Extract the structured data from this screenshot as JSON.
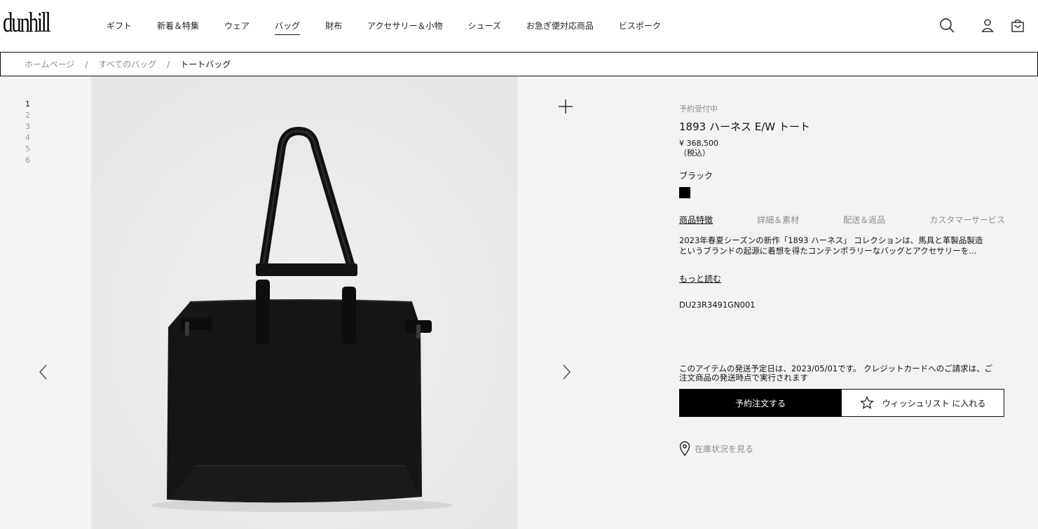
{
  "brand": {
    "logo_text": "dunhill"
  },
  "nav": {
    "items": [
      {
        "label": "ギフト"
      },
      {
        "label": "新着＆特集"
      },
      {
        "label": "ウェア"
      },
      {
        "label": "バッグ"
      },
      {
        "label": "財布"
      },
      {
        "label": "アクセサリー＆小物"
      },
      {
        "label": "シューズ"
      },
      {
        "label": "お急ぎ便対応商品"
      },
      {
        "label": "ビスポーク"
      }
    ],
    "active_index": 3
  },
  "header_icons": [
    "search-icon",
    "account-icon",
    "bag-icon"
  ],
  "breadcrumb": {
    "items": [
      "ホームページ",
      "すべてのバッグ",
      "トートバッグ"
    ],
    "separator": "/"
  },
  "gallery": {
    "thumbnails": [
      "1",
      "2",
      "3",
      "4",
      "5",
      "6"
    ],
    "active_index": 0
  },
  "product": {
    "status": "予約受付中",
    "title": "1893 ハーネス E/W トート",
    "price": "¥ 368,500",
    "tax_note": "（税込）",
    "color_name": "ブラック",
    "swatch_color": "#000000",
    "tabs": [
      "商品特徴",
      "詳細＆素材",
      "配送＆返品",
      "カスタマーサービス"
    ],
    "description_line1": "2023年春夏シーズンの新作「1893 ハーネス」 コレクションは、馬具と革製品製造",
    "description_line2": "というブランドの起源に着想を得たコンテンポラリーなバッグとアクセサリーを...",
    "read_more": "もっと読む",
    "sku": "DU23R3491GN001",
    "shipping_line1": "このアイテムの発送予定日は、2023/05/01です。 クレジットカードへのご請求は、ご",
    "shipping_line2": "注文商品の発送時点で実行されます",
    "order_button": "予約注文する",
    "wishlist_button": "ウィッシュリスト に入れる",
    "stock_link": "在庫状況を見る"
  },
  "colors": {
    "accent": "#000000",
    "muted_text": "#8a8a8a",
    "page_bg": "#f3f3f3"
  }
}
